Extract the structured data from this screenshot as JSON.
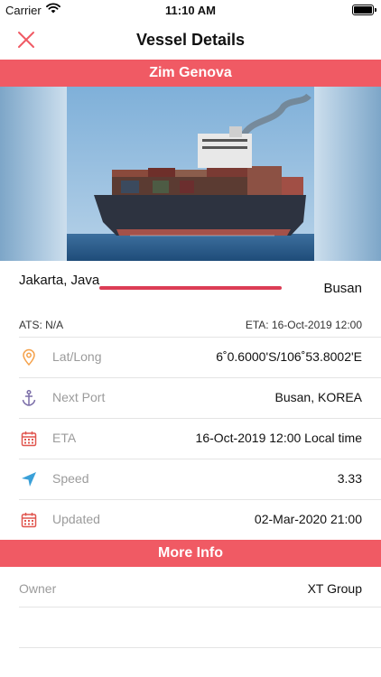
{
  "status_bar": {
    "carrier": "Carrier",
    "time": "11:10 AM"
  },
  "nav": {
    "title": "Vessel Details",
    "close_icon": "close-icon"
  },
  "vessel": {
    "name": "Zim Genova",
    "photo": "container-ship-photo"
  },
  "route": {
    "origin": "Jakarta, Java",
    "destination": "Busan"
  },
  "times": {
    "ats": "ATS: N/A",
    "eta": "ETA: 16-Oct-2019 12:00"
  },
  "details": [
    {
      "icon": "location-pin-icon",
      "label": "Lat/Long",
      "value": "6˚0.6000'S/106˚53.8002'E"
    },
    {
      "icon": "anchor-icon",
      "label": "Next Port",
      "value": "Busan, KOREA"
    },
    {
      "icon": "calendar-icon",
      "label": "ETA",
      "value": "16-Oct-2019 12:00 Local time"
    },
    {
      "icon": "navigation-arrow-icon",
      "label": "Speed",
      "value": "3.33"
    },
    {
      "icon": "calendar-icon",
      "label": "Updated",
      "value": "02-Mar-2020 21:00"
    }
  ],
  "more_info": {
    "title": "More Info",
    "rows": [
      {
        "label": "Owner",
        "value": "XT Group"
      }
    ]
  },
  "colors": {
    "accent": "#f05a64",
    "route_line": "#dc3d55",
    "icon_orange": "#f5a14a",
    "icon_purple": "#7b6ea8",
    "icon_red": "#e0554e",
    "icon_blue": "#3aa0d8"
  }
}
